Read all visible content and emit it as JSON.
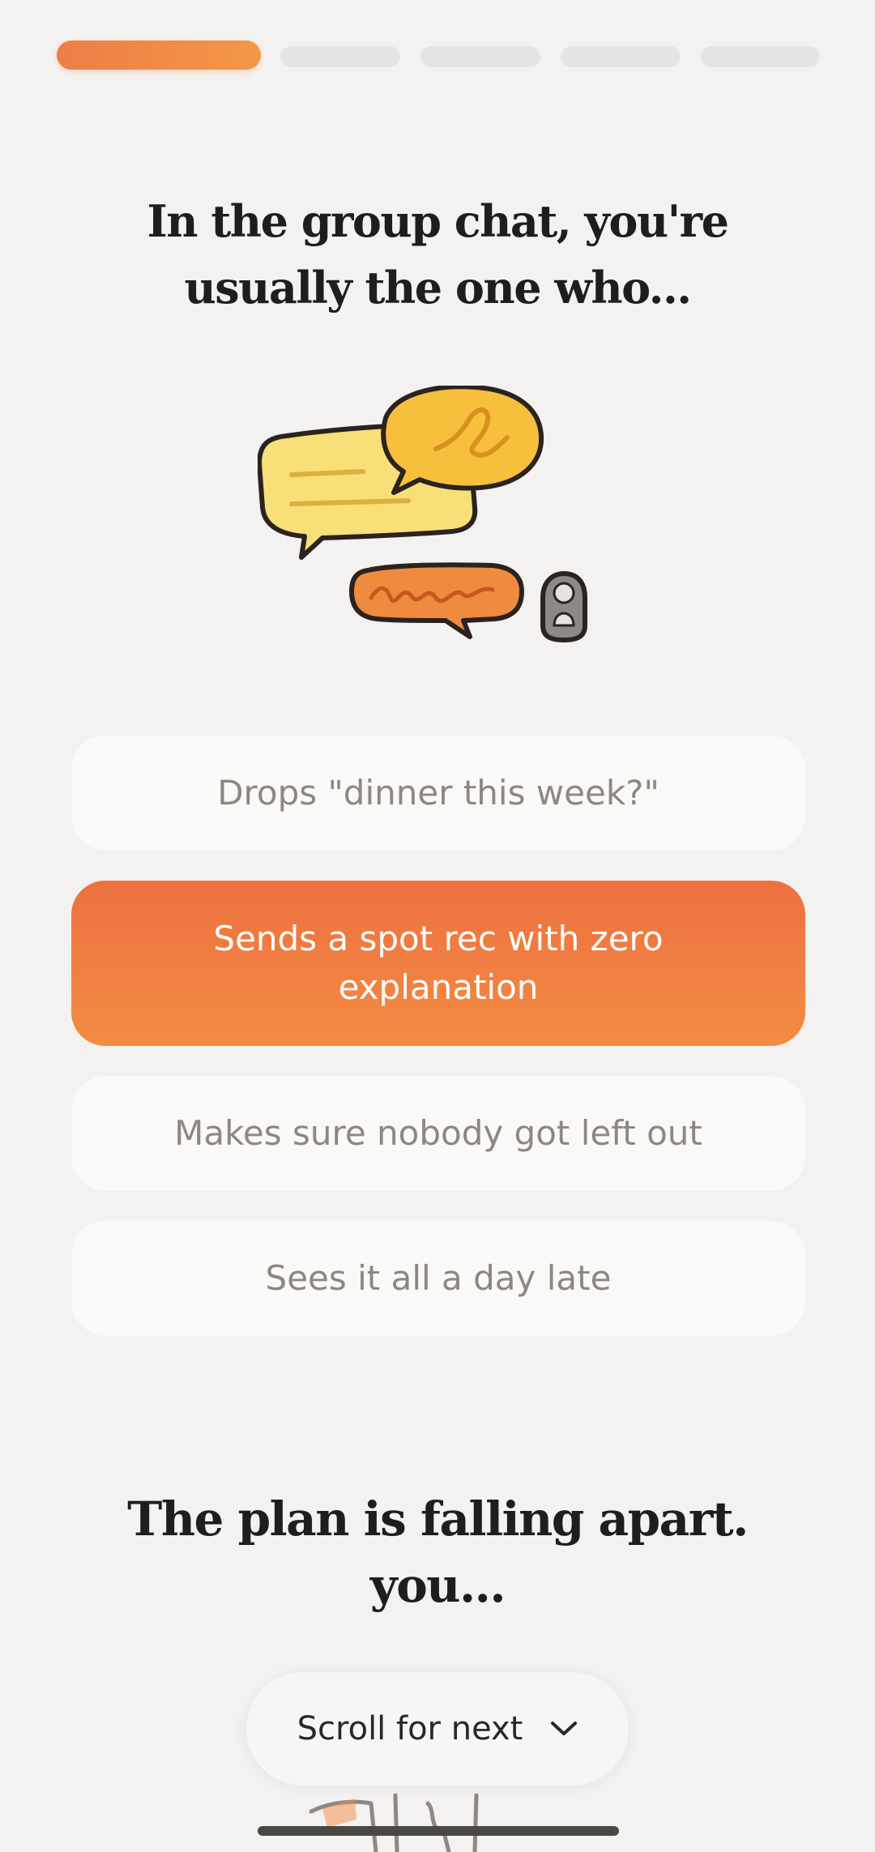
{
  "progress": {
    "total_steps": 5,
    "current_step": 1
  },
  "question1": {
    "title_line1": "In the group chat, you're",
    "title_line2": "usually the one who..."
  },
  "options": [
    {
      "label": "Drops \"dinner this week?\"",
      "selected": false
    },
    {
      "label": "Sends a spot rec with zero explanation",
      "selected": true
    },
    {
      "label": "Makes sure nobody got left out",
      "selected": false
    },
    {
      "label": "Sees it all a day late",
      "selected": false
    }
  ],
  "question2": {
    "title_line1": "The plan is falling apart.",
    "title_line2": "you..."
  },
  "scroll_button": {
    "label": "Scroll for next"
  },
  "colors": {
    "accent": "#ee7d45",
    "accent_light": "#f38c43",
    "background": "#f4f2f0",
    "option_bg": "#faf9f7",
    "option_text": "#8b8884"
  }
}
